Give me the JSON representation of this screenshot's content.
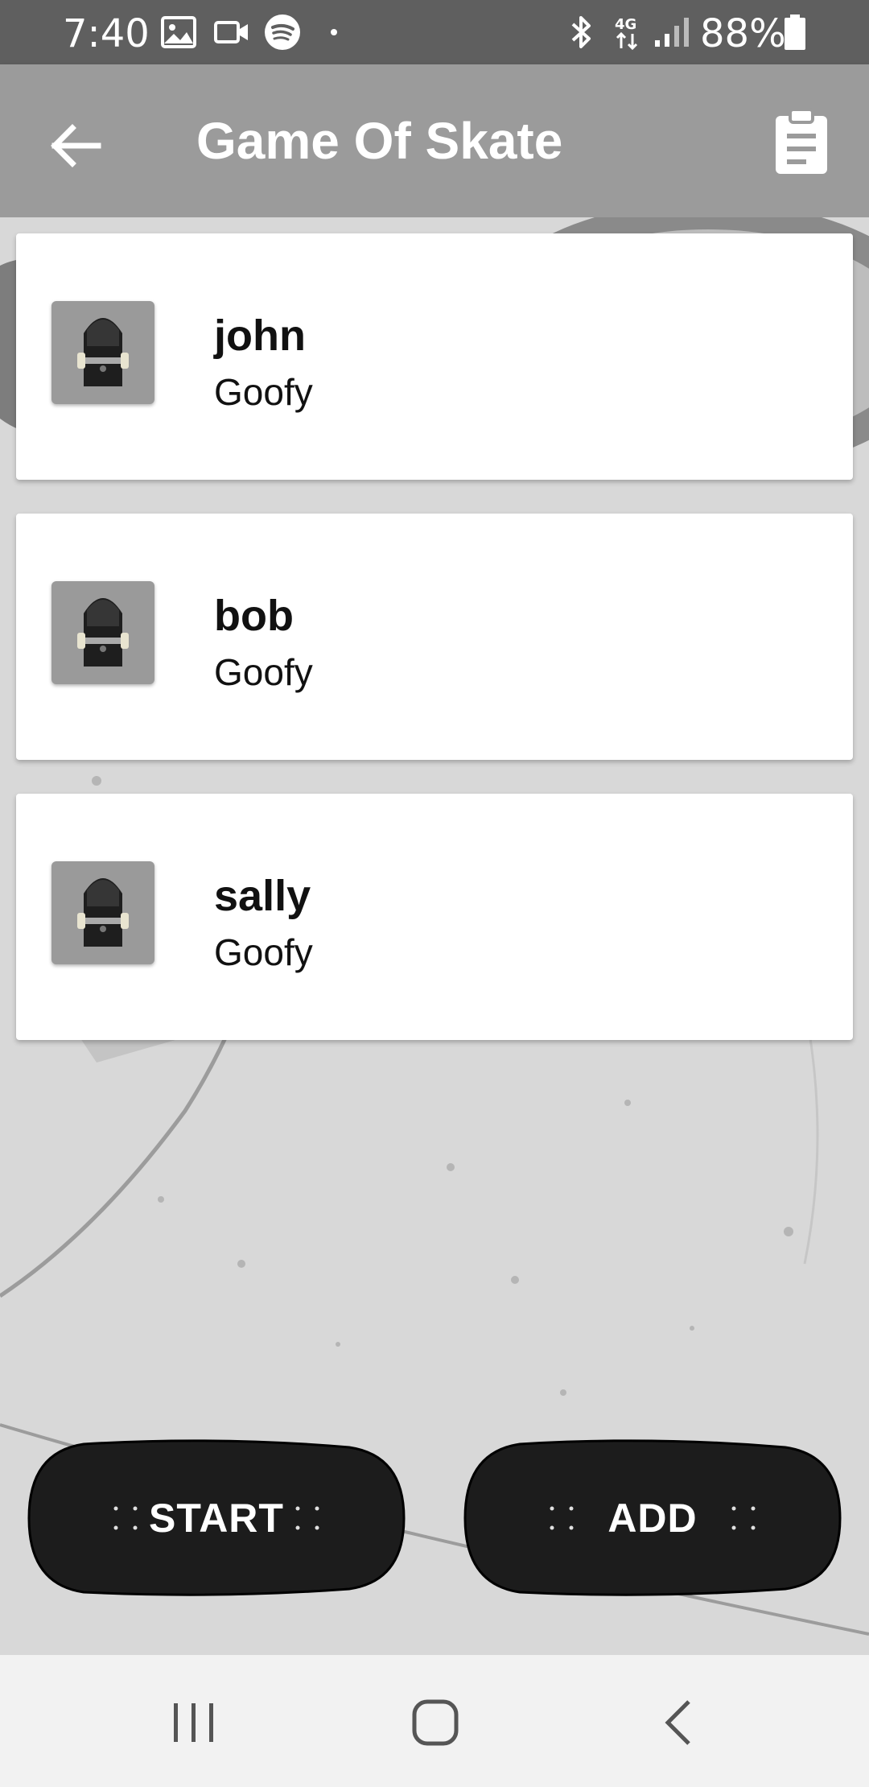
{
  "status_bar": {
    "time": "7:40",
    "battery_percent": "88%",
    "icons": [
      "gallery-icon",
      "video-icon",
      "spotify-icon",
      "dot-icon",
      "bluetooth-icon",
      "4g-icon",
      "signal-icon",
      "battery-icon"
    ]
  },
  "app_bar": {
    "title": "Game Of Skate",
    "back_icon": "arrow-back-icon",
    "action_icon": "clipboard-icon"
  },
  "players": [
    {
      "name": "john",
      "stance": "Goofy"
    },
    {
      "name": "bob",
      "stance": "Goofy"
    },
    {
      "name": "sally",
      "stance": "Goofy"
    }
  ],
  "buttons": {
    "start": "START",
    "add": "ADD"
  },
  "nav_bar": {
    "icons": [
      "recents-icon",
      "home-icon",
      "back-icon"
    ]
  },
  "colors": {
    "status_bar": "#5f5f5f",
    "app_bar": "#9b9b9b",
    "deck": "#1c1c1c",
    "card": "#ffffff"
  }
}
